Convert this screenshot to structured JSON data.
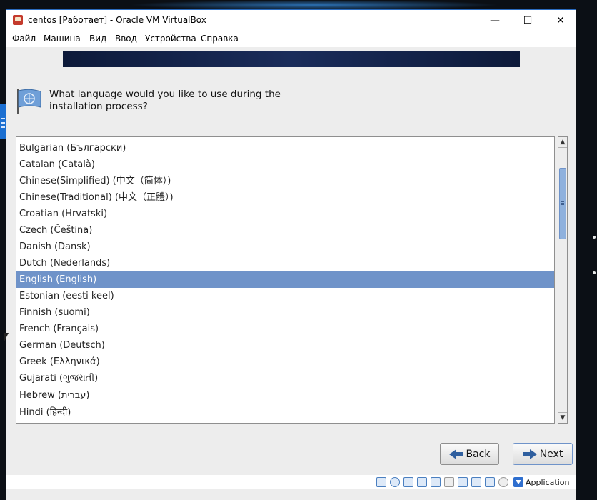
{
  "window": {
    "title": "centos [Работает] - Oracle VM VirtualBox",
    "minimize_glyph": "—",
    "maximize_glyph": "☐",
    "close_glyph": "✕"
  },
  "menubar": {
    "items": [
      "Файл",
      "Машина",
      "Вид",
      "Ввод",
      "Устройства",
      "Справка"
    ]
  },
  "installer": {
    "question": "What language would you like to use during the installation process?",
    "languages": [
      "Bulgarian (Български)",
      "Catalan (Català)",
      "Chinese(Simplified) (中文（简体）)",
      "Chinese(Traditional) (中文（正體）)",
      "Croatian (Hrvatski)",
      "Czech (Čeština)",
      "Danish (Dansk)",
      "Dutch (Nederlands)",
      "English (English)",
      "Estonian (eesti keel)",
      "Finnish (suomi)",
      "French (Français)",
      "German (Deutsch)",
      "Greek (Ελληνικά)",
      "Gujarati (ગુજરાતી)",
      "Hebrew (עברית)",
      "Hindi (हिन्दी)"
    ],
    "selected_language": "English (English)",
    "back_label": "Back",
    "next_label": "Next",
    "scroll_up_glyph": "▲",
    "scroll_down_glyph": "▼"
  },
  "statusbar": {
    "icons": [
      "hard-disk-icon",
      "optical-drive-icon",
      "audio-icon",
      "network-icon",
      "usb-icon",
      "shared-folder-icon",
      "display-icon",
      "recording-icon",
      "cpu-icon",
      "mouse-integration-icon",
      "host-key-icon"
    ],
    "host_key_label": "Application"
  },
  "colors": {
    "selection": "#6f93c9",
    "accent": "#2f5f9f"
  }
}
